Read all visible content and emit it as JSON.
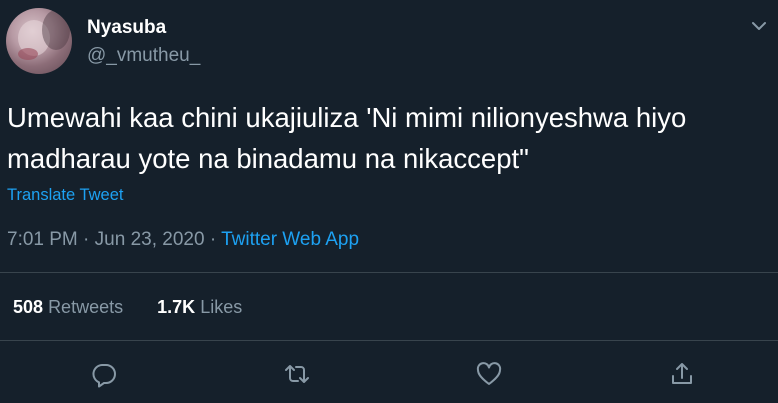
{
  "user": {
    "display_name": "Nyasuba",
    "handle": "@_vmutheu_"
  },
  "tweet": {
    "lines": [
      "Umewahi kaa chini ukajiuliza 'Ni mimi nilionyeshwa hiyo",
      "madharau yote na binadamu na nikaccept\""
    ],
    "translate_label": "Translate Tweet",
    "time": "7:01 PM",
    "separator": "·",
    "date": "Jun 23, 2020",
    "source": "Twitter Web App"
  },
  "stats": {
    "retweets_count": "508",
    "retweets_label": "Retweets",
    "likes_count": "1.7K",
    "likes_label": "Likes"
  },
  "icons": {
    "more": "chevron-down-icon",
    "reply": "reply-icon",
    "retweet": "retweet-icon",
    "like": "heart-icon",
    "share": "share-icon"
  },
  "colors": {
    "background": "#15202b",
    "text": "#ffffff",
    "secondary": "#8899a6",
    "accent": "#1da1f2",
    "divider": "#38444d"
  }
}
